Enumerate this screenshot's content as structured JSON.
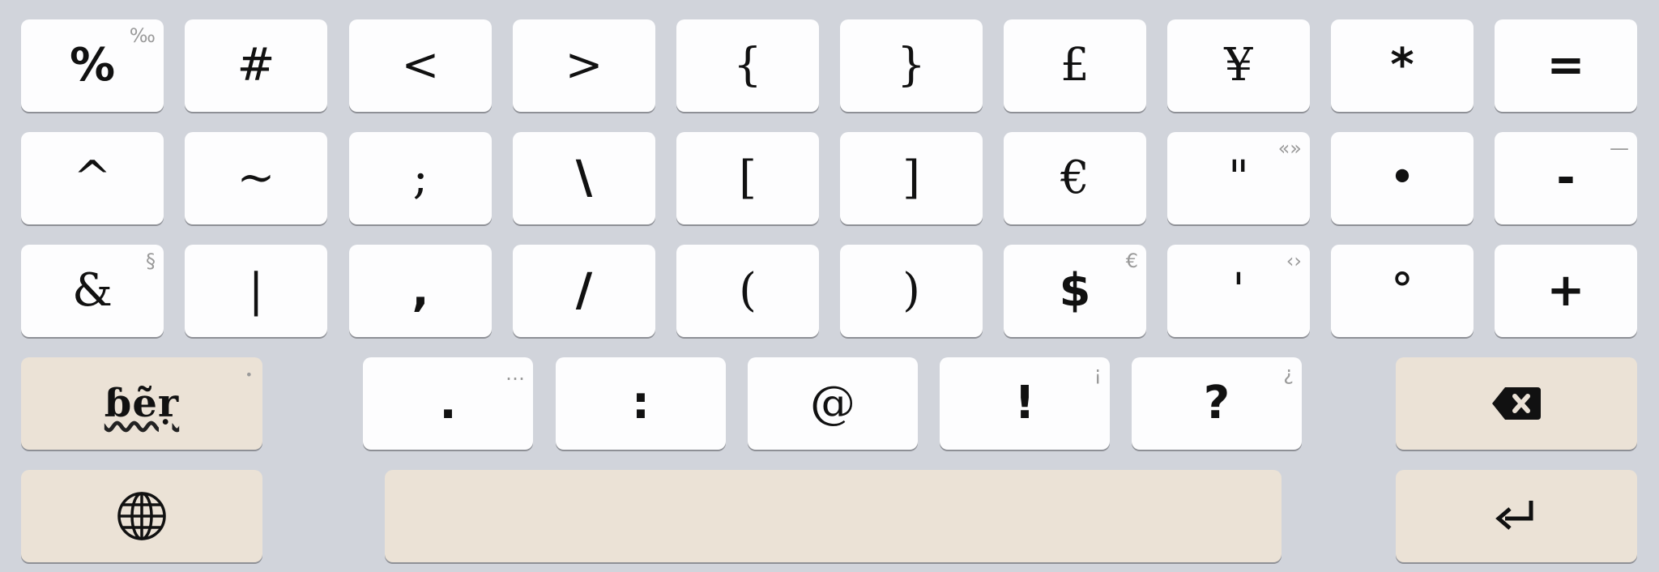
{
  "keyboard": {
    "rows": [
      [
        {
          "main": "%",
          "hint": "‰"
        },
        {
          "main": "#"
        },
        {
          "main": "<"
        },
        {
          "main": ">"
        },
        {
          "main": "{"
        },
        {
          "main": "}"
        },
        {
          "main": "£"
        },
        {
          "main": "¥"
        },
        {
          "main": "*"
        },
        {
          "main": "="
        }
      ],
      [
        {
          "main": "^"
        },
        {
          "main": "~"
        },
        {
          "main": ";"
        },
        {
          "main": "\\"
        },
        {
          "main": "["
        },
        {
          "main": "]"
        },
        {
          "main": "€"
        },
        {
          "main": "\"",
          "hint": "«»"
        },
        {
          "main": "•"
        },
        {
          "main": "-",
          "hint": "—"
        }
      ],
      [
        {
          "main": "&",
          "hint": "§"
        },
        {
          "main": "|"
        },
        {
          "main": ","
        },
        {
          "main": "/"
        },
        {
          "main": "("
        },
        {
          "main": ")"
        },
        {
          "main": "$",
          "hint": "€"
        },
        {
          "main": "'",
          "hint": "‹›"
        },
        {
          "main": "°"
        },
        {
          "main": "+"
        }
      ],
      [
        {
          "main": ".",
          "hint": "…"
        },
        {
          "main": ":"
        },
        {
          "main": "@"
        },
        {
          "main": "!",
          "hint": "¡"
        },
        {
          "main": "?",
          "hint": "¿"
        }
      ]
    ],
    "layout_switch": {
      "label": "ɓẽṛ",
      "hint": "•"
    },
    "space": {
      "label": ""
    },
    "icons": {
      "backspace": "backspace-icon",
      "globe": "globe-icon",
      "enter": "enter-icon"
    },
    "colors": {
      "background": "#d1d4db",
      "key": "#fdfdfe",
      "function_key": "#ebe2d6",
      "hint": "#9a9a9a"
    }
  }
}
